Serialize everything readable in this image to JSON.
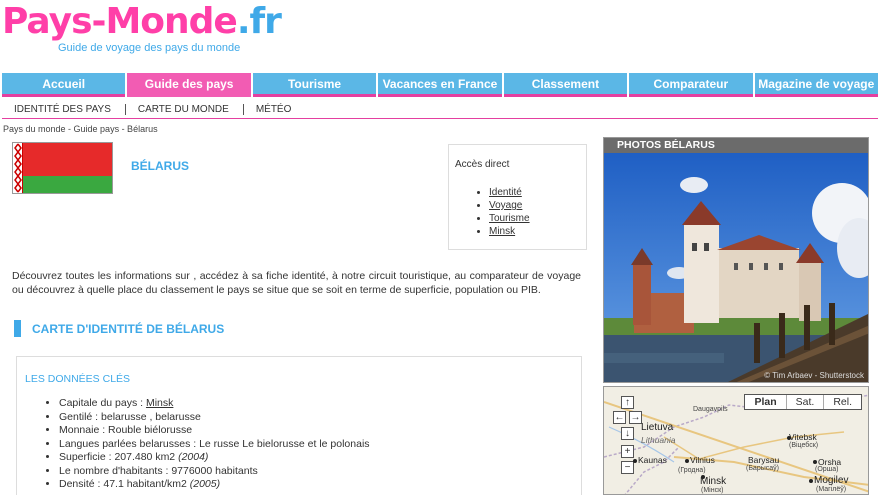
{
  "site": {
    "logo_a": "Pays-Monde",
    "logo_b": ".fr",
    "tagline": "Guide de voyage des pays du monde"
  },
  "mainnav": [
    "Accueil",
    "Guide des pays",
    "Tourisme",
    "Vacances en France",
    "Classement",
    "Comparateur",
    "Magazine de voyage"
  ],
  "subnav": [
    "IDENTITÉ DES PAYS",
    "CARTE DU MONDE",
    "MÉTÉO"
  ],
  "breadcrumb": "Pays du monde - Guide pays - Bélarus",
  "country": {
    "title": "BÉLARUS"
  },
  "acces": {
    "title": "Accès direct",
    "links": [
      "Identité",
      "Voyage",
      "Tourisme",
      "Minsk"
    ]
  },
  "intro": "Découvrez toutes les informations sur , accédez à sa fiche identité, à notre circuit touristique, au comparateur de voyage ou découvrez à quelle place du classement le pays se situe que se soit en terme de superficie, population ou PIB.",
  "section_title": "CARTE D'IDENTITÉ DE BÉLARUS",
  "keydata": {
    "title": "LES DONNÉES CLÉS",
    "capital_label": "Capitale du pays : ",
    "capital": "Minsk",
    "gentile": "Gentilé : belarusse , belarusse",
    "monnaie": "Monnaie : Rouble biélorusse",
    "langues": "Langues parlées belarusses : Le russe Le bielorusse et le polonais",
    "superficie": "Superficie : 207.480 km2",
    "superficie_year": "(2004)",
    "habitants": "Le nombre d'habitants : 9776000 habitants",
    "densite": "Densité : 47.1 habitant/km2",
    "densite_year": "(2005)"
  },
  "photos": {
    "title": "PHOTOS BÉLARUS",
    "credit": "© Tim Arbaev - Shutterstock"
  },
  "map": {
    "types": [
      "Plan",
      "Sat.",
      "Rel."
    ],
    "controls": [
      "↑",
      "←",
      "→",
      "↓",
      "+",
      "−"
    ],
    "labels": {
      "daugavpils": "Daugavpils",
      "lietuva": "Lietuva",
      "lithuania": "Lithuania",
      "kaunas": "Kaunas",
      "vilnius": "Vilnius",
      "vitebsk": "Vitebsk",
      "vitebsk_ru": "(Віцебск)",
      "barysau": "Barysau",
      "barysau_ru": "(Барысаў)",
      "orsha": "Orsha",
      "orsha_ru": "(Орша)",
      "minsk": "Minsk",
      "minsk_ru": "(Мінск)",
      "mogilev": "Mogilev",
      "mogilev_ru": "(Магілёў)",
      "hrodna_ru": "(Гродна)"
    }
  },
  "colors": {
    "pink": "#f25cb3",
    "blue": "#5bb7e6",
    "title_blue": "#3fa9e8"
  }
}
